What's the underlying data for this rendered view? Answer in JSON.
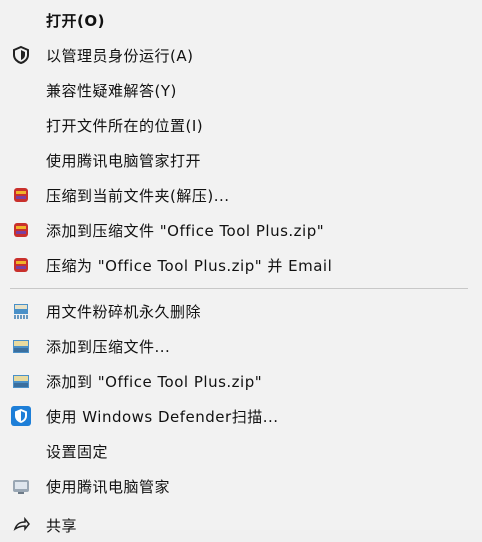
{
  "menu": {
    "items": [
      {
        "label": "打开(O)",
        "icon": "none",
        "bold": true
      },
      {
        "label": "以管理员身份运行(A)",
        "icon": "shield-icon"
      },
      {
        "label": "兼容性疑难解答(Y)",
        "icon": "none"
      },
      {
        "label": "打开文件所在的位置(I)",
        "icon": "none"
      },
      {
        "label": "使用腾讯电脑管家打开",
        "icon": "none"
      },
      {
        "label": "压缩到当前文件夹(解压)...",
        "icon": "winrar-icon"
      },
      {
        "label": "添加到压缩文件 \"Office Tool Plus.zip\"",
        "icon": "winrar-icon"
      },
      {
        "label": "压缩为 \"Office Tool Plus.zip\" 并 Email",
        "icon": "winrar-icon"
      },
      {
        "label": "用文件粉碎机永久删除",
        "icon": "shredder-icon"
      },
      {
        "label": "添加到压缩文件...",
        "icon": "archive-icon"
      },
      {
        "label": "添加到 \"Office Tool Plus.zip\"",
        "icon": "archive-icon"
      },
      {
        "label": "使用 Windows Defender扫描...",
        "icon": "defender-icon"
      },
      {
        "label": "设置固定",
        "icon": "none"
      },
      {
        "label": "使用腾讯电脑管家",
        "icon": "device-icon"
      },
      {
        "label": "共享",
        "icon": "share-icon"
      }
    ]
  },
  "colors": {
    "background": "#f2f2f2",
    "separator": "#c8c8c8",
    "winrar": "#c9302c",
    "defender": "#1e7fd8"
  }
}
